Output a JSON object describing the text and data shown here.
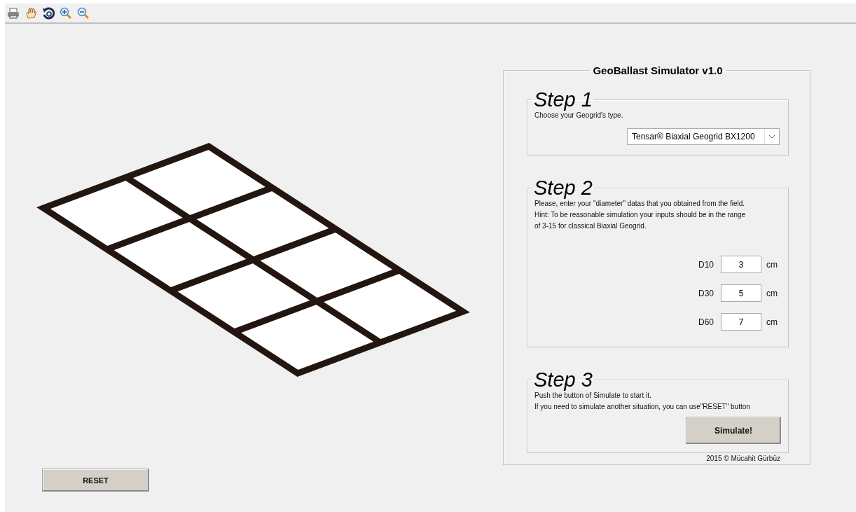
{
  "panel": {
    "title": "GeoBallast Simulator v1.0",
    "steps": [
      {
        "kind": "select",
        "title": "Step 1",
        "lines": [
          "Choose your Geogrid's type."
        ],
        "select": {
          "value": "Tensar® Biaxial Geogrid BX1200"
        }
      },
      {
        "kind": "inputs",
        "title": "Step 2",
        "lines": [
          "Please, enter your \"diameter\" datas that you obtained from the field.",
          "Hint: To be reasonable simulation your inputs should be in the range",
          "of 3-15 for classical Biaxial Geogrid."
        ],
        "fields": [
          {
            "label": "D10",
            "value": "3",
            "unit": "cm"
          },
          {
            "label": "D30",
            "value": "5",
            "unit": "cm"
          },
          {
            "label": "D60",
            "value": "7",
            "unit": "cm"
          }
        ]
      },
      {
        "kind": "button",
        "title": "Step 3",
        "lines": [
          "Push the button of Simulate to start it.",
          "If you need to simulate another situation, you can use\"RESET\" button"
        ],
        "button": "Simulate!"
      }
    ],
    "footer": "2015 © Mücahit Gürbüz"
  },
  "reset_button": "RESET"
}
